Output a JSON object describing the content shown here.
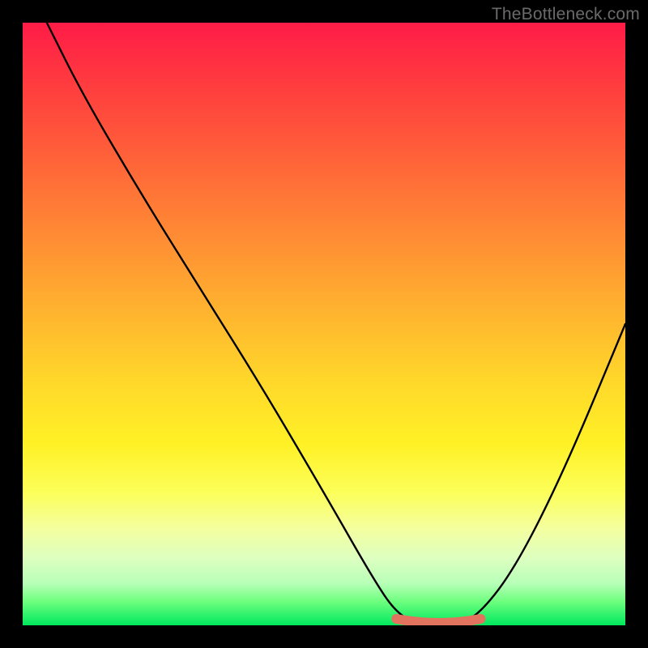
{
  "watermark": "TheBottleneck.com",
  "colors": {
    "background": "#000000",
    "accent_red": "#ff1b47",
    "accent_green": "#00e85e",
    "curve": "#000000",
    "marker": "#e2735f"
  },
  "chart_data": {
    "type": "line",
    "title": "",
    "xlabel": "",
    "ylabel": "",
    "xlim": [
      0,
      100
    ],
    "ylim": [
      0,
      100
    ],
    "grid": false,
    "series": [
      {
        "name": "bottleneck-curve",
        "x": [
          4,
          10,
          20,
          30,
          40,
          50,
          58,
          62,
          66,
          72,
          76,
          82,
          90,
          100
        ],
        "values": [
          100,
          88,
          71,
          55,
          39,
          22,
          8,
          2,
          0,
          0,
          2,
          10,
          26,
          50
        ]
      }
    ],
    "optimal_range": {
      "x_start": 62,
      "x_end": 76,
      "y": 0
    },
    "annotations": []
  }
}
